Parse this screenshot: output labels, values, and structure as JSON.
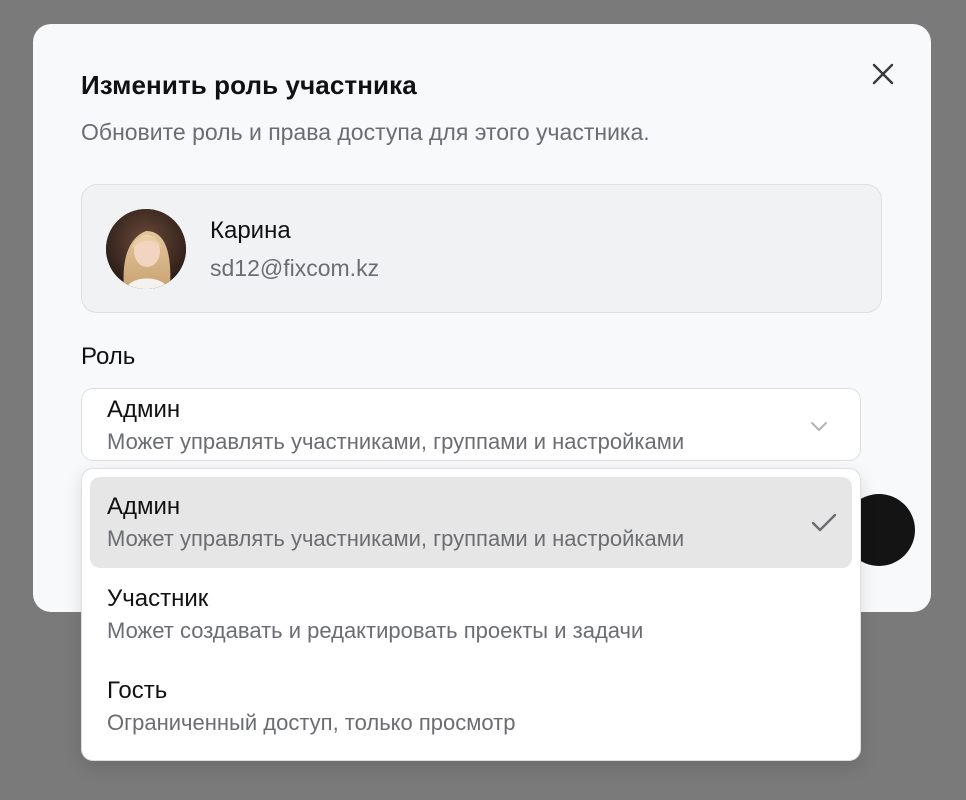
{
  "modal": {
    "title": "Изменить роль участника",
    "subtitle": "Обновите роль и права доступа для этого участника."
  },
  "user": {
    "name": "Карина",
    "email": "sd12@fixcom.kz"
  },
  "role": {
    "label": "Роль",
    "selected": {
      "title": "Админ",
      "description": "Может управлять участниками, группами и настройками"
    },
    "options": [
      {
        "title": "Админ",
        "description": "Может управлять участниками, группами и настройками",
        "selected": true
      },
      {
        "title": "Участник",
        "description": "Может создавать и редактировать проекты и задачи",
        "selected": false
      },
      {
        "title": "Гость",
        "description": "Ограниченный доступ, только просмотр",
        "selected": false
      }
    ]
  },
  "icons": {
    "close": "close-icon",
    "chevron": "chevron-down-icon",
    "check": "check-icon"
  },
  "colors": {
    "backdrop": "#7a7a7a",
    "modal_bg": "#f8f9fb",
    "card_bg": "#f1f2f4",
    "selected_option_bg": "#e6e6e7",
    "primary_text": "#111111",
    "secondary_text": "#6b6d72",
    "border": "#dedfe3",
    "dark_button": "#141414"
  }
}
